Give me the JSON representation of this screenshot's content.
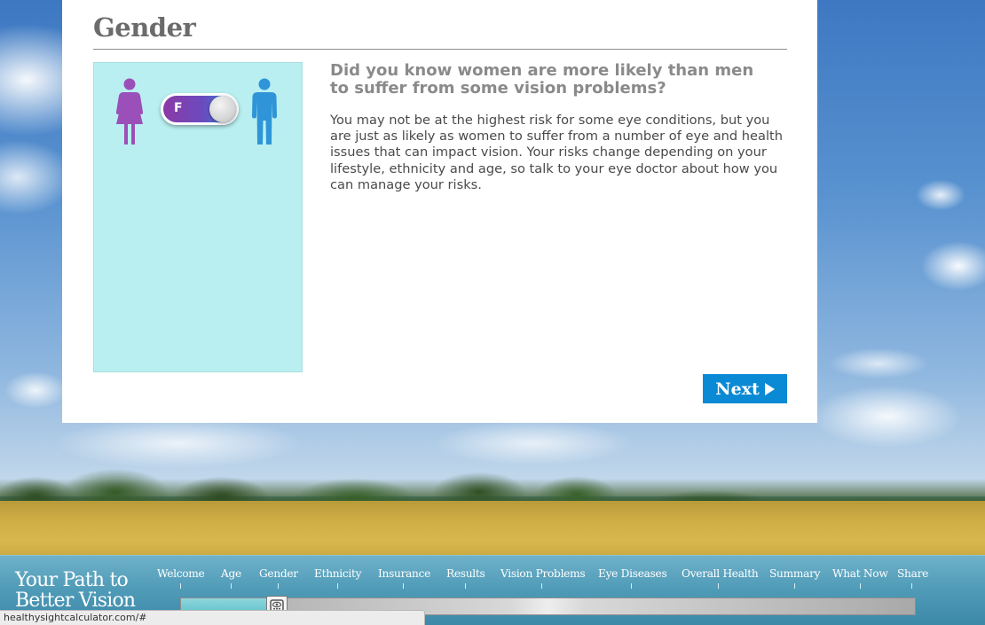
{
  "page": {
    "title": "Gender"
  },
  "gender_selector": {
    "toggle_label": "F",
    "selected": "female",
    "female_icon": "female-figure-icon",
    "male_icon": "male-figure-icon",
    "colors": {
      "female": "#9b4fb8",
      "male": "#2f95d8",
      "panel": "#b9eff1"
    }
  },
  "info": {
    "heading": "Did you know women are more likely than men to suffer from some vision problems?",
    "body": "You may not be at the highest risk for some eye conditions, but you are just as likely as women to suffer from a number of eye and health issues that can impact vision. Your risks change depending on your lifestyle, ethnicity and age, so talk to your eye doctor about how you can manage your risks."
  },
  "next_button": {
    "label": "Next",
    "icon": "play-arrow-icon",
    "color": "#0a8ad4"
  },
  "footer": {
    "brand_line1": "Your Path to",
    "brand_line2": "Better Vision",
    "nav": [
      "Welcome",
      "Age",
      "Gender",
      "Ethnicity",
      "Insurance",
      "Results",
      "Vision Problems",
      "Eye Diseases",
      "Overall Health",
      "Summary",
      "What Now",
      "Share"
    ],
    "progress_fraction": 0.13,
    "handle_icon": "eye-chart-icon"
  },
  "status_bar": {
    "url": "healthysightcalculator.com/#"
  }
}
